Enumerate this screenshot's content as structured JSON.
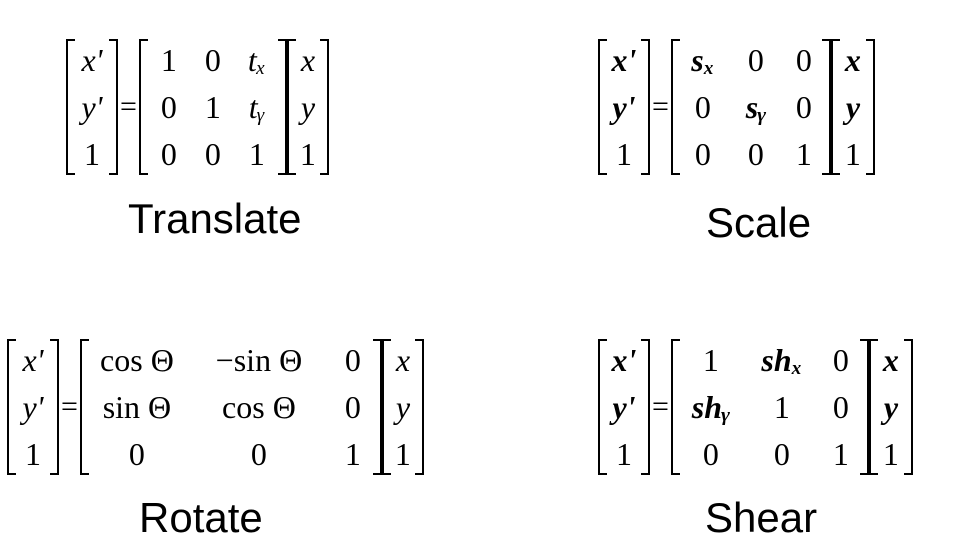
{
  "panels": {
    "translate": {
      "title": "Translate",
      "lhs": [
        "x'",
        "y'",
        "1"
      ],
      "matrix": [
        [
          "1",
          "0",
          "tₓ"
        ],
        [
          "0",
          "1",
          "tᵧ"
        ],
        [
          "0",
          "0",
          "1"
        ]
      ],
      "rhs": [
        "x",
        "y",
        "1"
      ]
    },
    "scale": {
      "title": "Scale",
      "lhs": [
        "x'",
        "y'",
        "1"
      ],
      "matrix": [
        [
          "sₓ",
          "0",
          "0"
        ],
        [
          "0",
          "sᵧ",
          "0"
        ],
        [
          "0",
          "0",
          "1"
        ]
      ],
      "rhs": [
        "x",
        "y",
        "1"
      ]
    },
    "rotate": {
      "title": "Rotate",
      "lhs": [
        "x'",
        "y'",
        "1"
      ],
      "matrix": [
        [
          "cos Θ",
          "−sin Θ",
          "0"
        ],
        [
          "sin Θ",
          "cos Θ",
          "0"
        ],
        [
          "0",
          "0",
          "1"
        ]
      ],
      "rhs": [
        "x",
        "y",
        "1"
      ]
    },
    "shear": {
      "title": "Shear",
      "lhs": [
        "x'",
        "y'",
        "1"
      ],
      "matrix": [
        [
          "1",
          "shₓ",
          "0"
        ],
        [
          "shᵧ",
          "1",
          "0"
        ],
        [
          "0",
          "0",
          "1"
        ]
      ],
      "rhs": [
        "x",
        "y",
        "1"
      ]
    }
  },
  "equals": "="
}
